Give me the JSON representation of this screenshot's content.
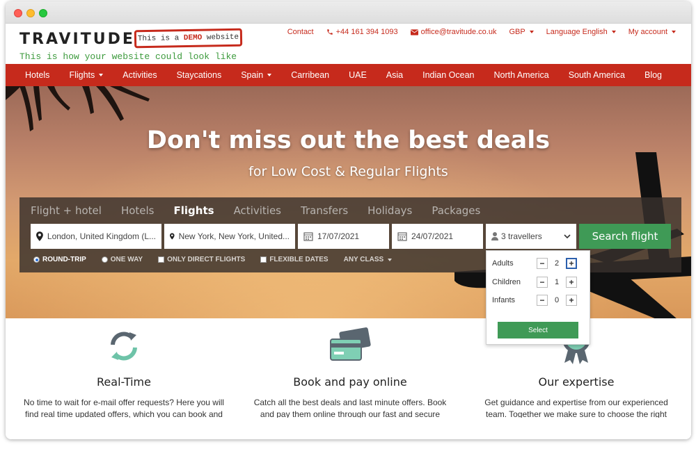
{
  "brand": {
    "logo_text": "TRAVITUDE",
    "demo_prefix": "This is a ",
    "demo_strong": "DEMO",
    "demo_suffix": " website",
    "tagline": "This is how your website could look like",
    "accent_color": "#c62a1c",
    "green_color": "#3f9a56"
  },
  "toplinks": {
    "contact": "Contact",
    "phone": "+44 161 394 1093",
    "email": "office@travitude.co.uk",
    "currency": "GBP",
    "language": "Language English",
    "account": "My account"
  },
  "nav": {
    "items": [
      {
        "label": "Hotels"
      },
      {
        "label": "Flights"
      },
      {
        "label": "Activities"
      },
      {
        "label": "Staycations"
      },
      {
        "label": "Spain"
      },
      {
        "label": "Carribean"
      },
      {
        "label": "UAE"
      },
      {
        "label": "Asia"
      },
      {
        "label": "Indian Ocean"
      },
      {
        "label": "North America"
      },
      {
        "label": "South America"
      },
      {
        "label": "Blog"
      }
    ]
  },
  "hero": {
    "title": "Don't miss out the best deals",
    "subtitle": "for Low Cost & Regular Flights"
  },
  "search": {
    "tabs": [
      {
        "label": "Flight + hotel"
      },
      {
        "label": "Hotels"
      },
      {
        "label": "Flights"
      },
      {
        "label": "Activities"
      },
      {
        "label": "Transfers"
      },
      {
        "label": "Holidays"
      },
      {
        "label": "Packages"
      }
    ],
    "active_tab": "Flights",
    "from": "London, United Kingdom (L...",
    "to": "New York, New York, United...",
    "depart": "17/07/2021",
    "return": "24/07/2021",
    "travellers": "3 travellers",
    "button": "Search flight",
    "options": {
      "round_trip": "ROUND-TRIP",
      "one_way": "ONE WAY",
      "direct": "ONLY DIRECT FLIGHTS",
      "flexible": "FLEXIBLE DATES",
      "class": "ANY CLASS"
    }
  },
  "travellers_popup": {
    "rows": [
      {
        "label": "Adults",
        "count": "2"
      },
      {
        "label": "Children",
        "count": "1"
      },
      {
        "label": "Infants",
        "count": "0"
      }
    ],
    "minus": "−",
    "plus": "+",
    "select": "Select"
  },
  "features": [
    {
      "icon": "refresh-icon",
      "title": "Real-Time",
      "text": "No time to wait for e-mail offer requests? Here you will find real time updated offers, which you can book and"
    },
    {
      "icon": "credit-card-icon",
      "title": "Book and pay online",
      "text": "Catch all the best deals and last minute offers. Book and pay them online through our fast and secure"
    },
    {
      "icon": "award-icon",
      "title": "Our expertise",
      "text": "Get guidance and expertise from our experienced team. Together we make sure to choose the right"
    }
  ]
}
